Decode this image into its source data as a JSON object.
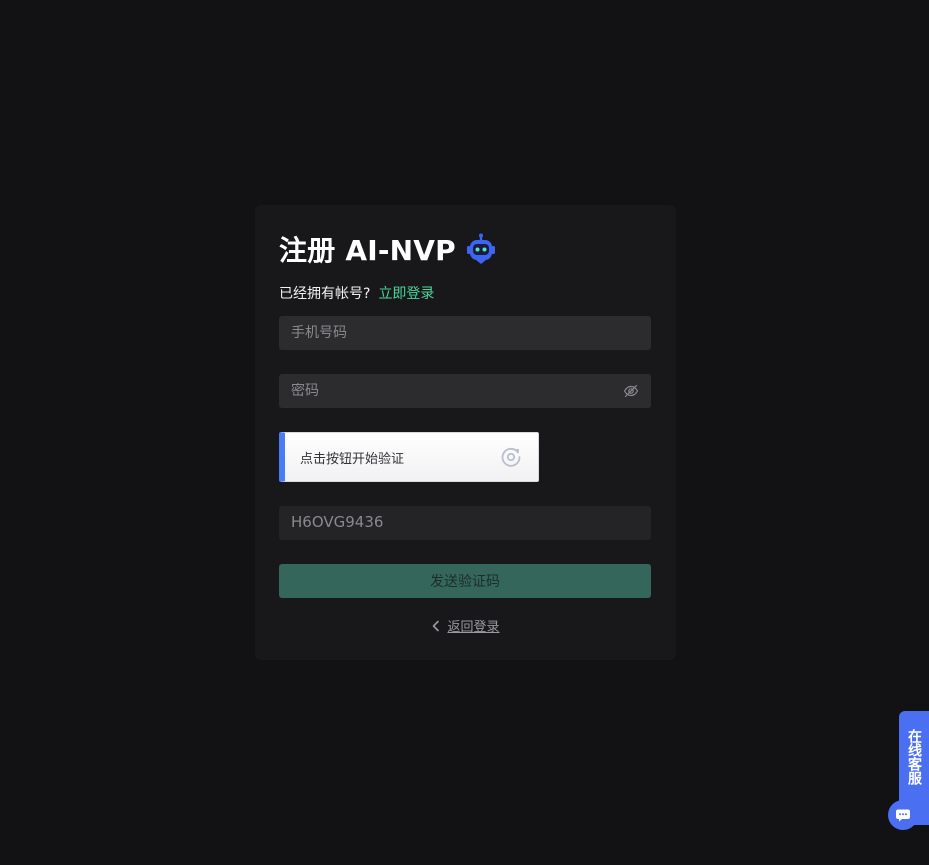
{
  "colors": {
    "page_bg": "#121214",
    "card_bg": "#18181b",
    "accent_green": "#4cd69a",
    "button_green": "#34665b",
    "accent_blue": "#4a6ff0"
  },
  "register": {
    "title": "注册 AI-NVP",
    "title_icon": "robot-icon",
    "have_account_text": "已经拥有帐号?",
    "login_link": "立即登录",
    "phone_placeholder": "手机号码",
    "password_placeholder": "密码",
    "password_toggle_icon": "eye-off-icon",
    "captcha_label": "点击按钮开始验证",
    "captcha_icon": "captcha-refresh-icon",
    "code_placeholder": "H6OVG9436",
    "send_code_button": "发送验证码",
    "back_link": "返回登录",
    "back_icon": "chevron-left-icon"
  },
  "support": {
    "label": "在线客服",
    "icon": "chat-icon"
  }
}
